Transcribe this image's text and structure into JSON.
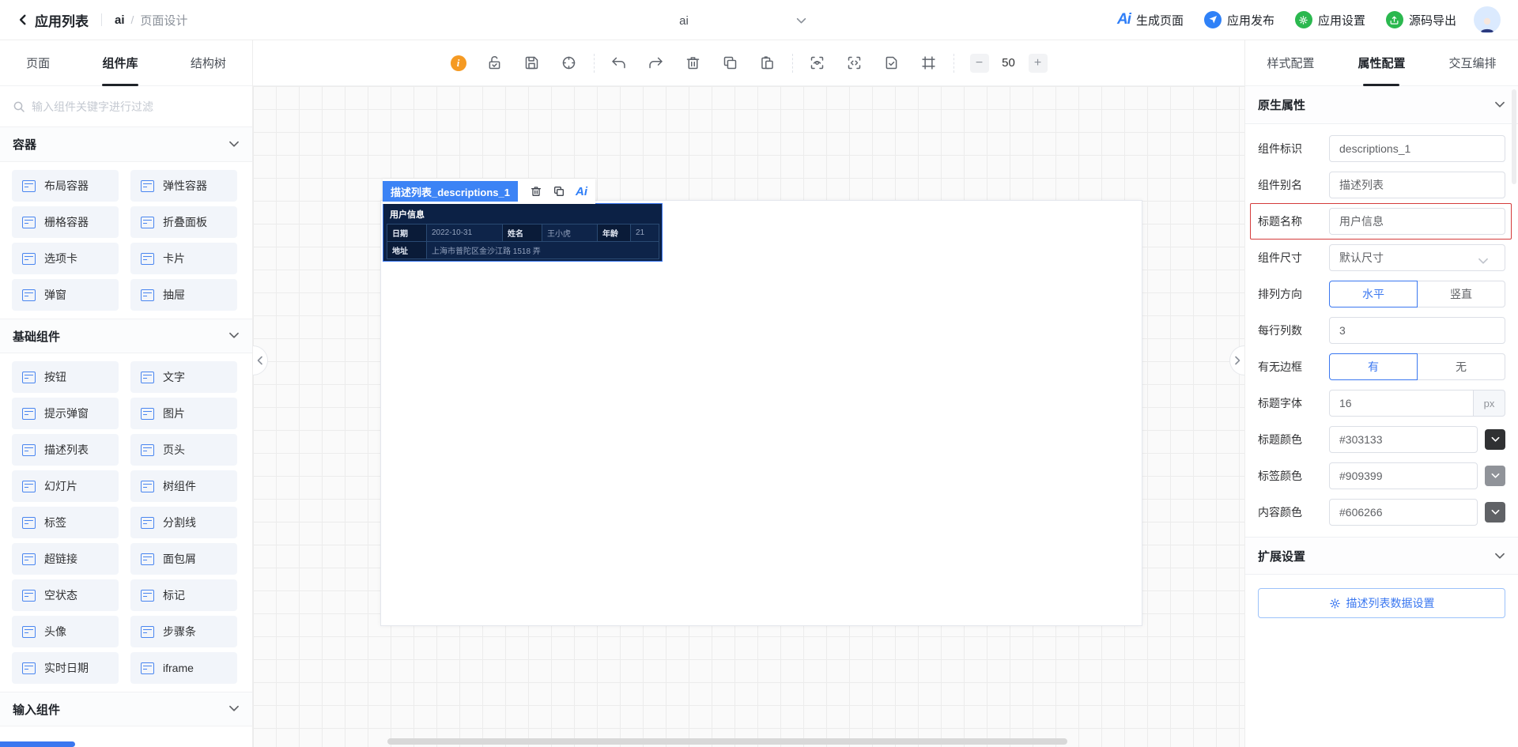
{
  "header": {
    "back_label": "应用列表",
    "breadcrumb_app": "ai",
    "breadcrumb_sep": "/",
    "breadcrumb_page": "页面设计",
    "page_select_value": "ai",
    "actions": [
      {
        "label": "生成页面",
        "icon": "ai-logo-icon",
        "color": "#2f7ef7"
      },
      {
        "label": "应用发布",
        "icon": "publish-icon",
        "color": "#2f81f7"
      },
      {
        "label": "应用设置",
        "icon": "settings-icon",
        "color": "#2bb84f"
      },
      {
        "label": "源码导出",
        "icon": "export-icon",
        "color": "#2bb84f"
      }
    ]
  },
  "left_panel": {
    "tabs": [
      {
        "label": "页面",
        "active": false
      },
      {
        "label": "组件库",
        "active": true
      },
      {
        "label": "结构树",
        "active": false
      }
    ],
    "search_placeholder": "输入组件关键字进行过滤",
    "sections": [
      {
        "title": "容器",
        "items": [
          {
            "label": "布局容器",
            "icon": "layout-container-icon"
          },
          {
            "label": "弹性容器",
            "icon": "flex-container-icon"
          },
          {
            "label": "栅格容器",
            "icon": "grid-container-icon"
          },
          {
            "label": "折叠面板",
            "icon": "collapse-panel-icon"
          },
          {
            "label": "选项卡",
            "icon": "tabs-icon"
          },
          {
            "label": "卡片",
            "icon": "card-icon"
          },
          {
            "label": "弹窗",
            "icon": "dialog-icon"
          },
          {
            "label": "抽屉",
            "icon": "drawer-icon"
          }
        ]
      },
      {
        "title": "基础组件",
        "items": [
          {
            "label": "按钮",
            "icon": "button-icon"
          },
          {
            "label": "文字",
            "icon": "text-icon"
          },
          {
            "label": "提示弹窗",
            "icon": "alert-dialog-icon"
          },
          {
            "label": "图片",
            "icon": "image-icon"
          },
          {
            "label": "描述列表",
            "icon": "descriptions-icon"
          },
          {
            "label": "页头",
            "icon": "page-header-icon"
          },
          {
            "label": "幻灯片",
            "icon": "carousel-icon"
          },
          {
            "label": "树组件",
            "icon": "tree-icon"
          },
          {
            "label": "标签",
            "icon": "tag-icon"
          },
          {
            "label": "分割线",
            "icon": "divider-icon"
          },
          {
            "label": "超链接",
            "icon": "hyperlink-icon"
          },
          {
            "label": "面包屑",
            "icon": "breadcrumb-icon"
          },
          {
            "label": "空状态",
            "icon": "empty-state-icon"
          },
          {
            "label": "标记",
            "icon": "mark-icon"
          },
          {
            "label": "头像",
            "icon": "avatar-icon"
          },
          {
            "label": "步骤条",
            "icon": "steps-icon"
          },
          {
            "label": "实时日期",
            "icon": "datetime-icon"
          },
          {
            "label": "iframe",
            "icon": "iframe-icon"
          }
        ]
      },
      {
        "title": "输入组件",
        "items": []
      }
    ]
  },
  "toolbar": {
    "zoom_value": "50",
    "info_glyph": "i"
  },
  "canvas": {
    "selected_component": {
      "badge": "描述列表_descriptions_1",
      "title": "用户信息",
      "rows": [
        {
          "cells": [
            {
              "label": "日期",
              "value": "2022-10-31"
            },
            {
              "label": "姓名",
              "value": "王小虎"
            },
            {
              "label": "年龄",
              "value": "21"
            }
          ]
        },
        {
          "cells": [
            {
              "label": "地址",
              "value": "上海市普陀区金沙江路 1518 弄",
              "colspan": 5
            }
          ]
        }
      ]
    }
  },
  "right_panel": {
    "tabs": [
      {
        "label": "样式配置",
        "active": false
      },
      {
        "label": "属性配置",
        "active": true
      },
      {
        "label": "交互编排",
        "active": false
      }
    ],
    "native_section_title": "原生属性",
    "extend_section_title": "扩展设置",
    "fields": [
      {
        "label": "组件标识",
        "type": "input",
        "value": "descriptions_1"
      },
      {
        "label": "组件别名",
        "type": "input",
        "value": "描述列表"
      },
      {
        "label": "标题名称",
        "type": "input",
        "value": "用户信息",
        "highlight": true
      },
      {
        "label": "组件尺寸",
        "type": "select",
        "value": "默认尺寸"
      },
      {
        "label": "排列方向",
        "type": "segmented",
        "options": [
          "水平",
          "竖直"
        ],
        "selected": 0
      },
      {
        "label": "每行列数",
        "type": "input",
        "value": "3"
      },
      {
        "label": "有无边框",
        "type": "segmented",
        "options": [
          "有",
          "无"
        ],
        "selected": 0
      },
      {
        "label": "标题字体",
        "type": "input-suffix",
        "value": "16",
        "suffix": "px"
      },
      {
        "label": "标题颜色",
        "type": "color",
        "value": "#303133",
        "swatch": "#303133"
      },
      {
        "label": "标签颜色",
        "type": "color",
        "value": "#909399",
        "swatch": "#909399"
      },
      {
        "label": "内容颜色",
        "type": "color",
        "value": "#606266",
        "swatch": "#606266"
      }
    ],
    "data_button_label": "描述列表数据设置"
  },
  "colors": {
    "accent": "#3a77f0",
    "badge": "#3c83f5",
    "highlight_red": "#d43b3b",
    "table_bg": "#0c2145",
    "table_label_bg": "#0a1b38",
    "table_value_bg": "#0e2449"
  }
}
